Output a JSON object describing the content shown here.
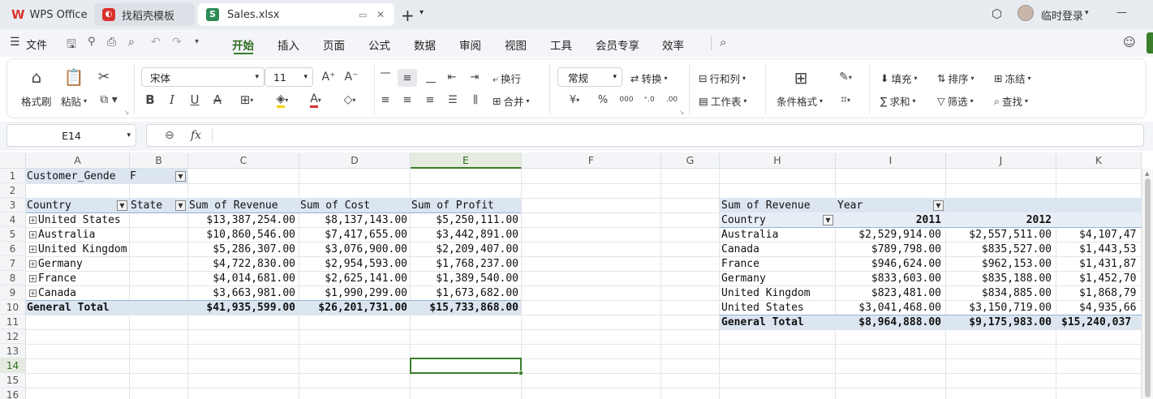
{
  "tabs": [
    {
      "label": "WPS Office",
      "icon": "wps-logo-icon"
    },
    {
      "label": "找稻壳模板",
      "icon": "docer-icon"
    },
    {
      "label": "Sales.xlsx",
      "icon": "spreadsheet-icon"
    }
  ],
  "window": {
    "login_label": "临时登录"
  },
  "menu": {
    "file_label": "文件",
    "items": [
      "开始",
      "插入",
      "页面",
      "公式",
      "数据",
      "审阅",
      "视图",
      "工具",
      "会员专享",
      "效率"
    ],
    "active": "开始"
  },
  "ribbon": {
    "format_painter": "格式刷",
    "paste": "粘贴",
    "font_name": "宋体",
    "font_size": "11",
    "wrap": "换行",
    "merge": "合并",
    "number_format": "常规",
    "convert": "转换",
    "rows_cols": "行和列",
    "worksheet": "工作表",
    "conditional_format": "条件格式",
    "fill": "填充",
    "sort": "排序",
    "freeze": "冻结",
    "sum": "求和",
    "filter": "筛选",
    "find": "查找"
  },
  "formula_bar": {
    "name_box": "E14",
    "fx": "fx",
    "formula": ""
  },
  "columns": [
    "A",
    "B",
    "C",
    "D",
    "E",
    "F",
    "G",
    "H",
    "I",
    "J",
    "K"
  ],
  "rows": [
    "1",
    "2",
    "3",
    "4",
    "5",
    "6",
    "7",
    "8",
    "9",
    "10",
    "11",
    "12",
    "13",
    "14",
    "15",
    "16"
  ],
  "selected_cell": "E14",
  "pivot1": {
    "filter_label": "Customer_Gende",
    "filter_value": "F",
    "headers": [
      "Country",
      "State",
      "Sum of Revenue",
      "Sum of Cost",
      "Sum of Profit"
    ],
    "rows": [
      {
        "country": "United States",
        "revenue": "$13,387,254.00",
        "cost": "$8,137,143.00",
        "profit": "$5,250,111.00"
      },
      {
        "country": "Australia",
        "revenue": "$10,860,546.00",
        "cost": "$7,417,655.00",
        "profit": "$3,442,891.00"
      },
      {
        "country": "United Kingdom",
        "revenue": "$5,286,307.00",
        "cost": "$3,076,900.00",
        "profit": "$2,209,407.00"
      },
      {
        "country": "Germany",
        "revenue": "$4,722,830.00",
        "cost": "$2,954,593.00",
        "profit": "$1,768,237.00"
      },
      {
        "country": "France",
        "revenue": "$4,014,681.00",
        "cost": "$2,625,141.00",
        "profit": "$1,389,540.00"
      },
      {
        "country": "Canada",
        "revenue": "$3,663,981.00",
        "cost": "$1,990,299.00",
        "profit": "$1,673,682.00"
      }
    ],
    "total": {
      "label": "General Total",
      "revenue": "$41,935,599.00",
      "cost": "$26,201,731.00",
      "profit": "$15,733,868.00"
    }
  },
  "pivot2": {
    "value_label": "Sum of Revenue",
    "col_field": "Year",
    "row_field": "Country",
    "years": [
      "2011",
      "2012"
    ],
    "rows": [
      {
        "country": "Australia",
        "y2011": "$2,529,914.00",
        "y2012": "$2,557,511.00",
        "k": "$4,107,47"
      },
      {
        "country": "Canada",
        "y2011": "$789,798.00",
        "y2012": "$835,527.00",
        "k": "$1,443,53"
      },
      {
        "country": "France",
        "y2011": "$946,624.00",
        "y2012": "$962,153.00",
        "k": "$1,431,87"
      },
      {
        "country": "Germany",
        "y2011": "$833,603.00",
        "y2012": "$835,188.00",
        "k": "$1,452,70"
      },
      {
        "country": "United Kingdom",
        "y2011": "$823,481.00",
        "y2012": "$834,885.00",
        "k": "$1,868,79"
      },
      {
        "country": "United States",
        "y2011": "$3,041,468.00",
        "y2012": "$3,150,719.00",
        "k": "$4,935,66"
      }
    ],
    "total": {
      "label": "General Total",
      "y2011": "$8,964,888.00",
      "y2012": "$9,175,983.00",
      "k": "$15,240,037"
    }
  },
  "colors": {
    "accent_green": "#3a7d2c",
    "pivot_header": "#dce6f1",
    "wps_red": "#d9322e"
  }
}
